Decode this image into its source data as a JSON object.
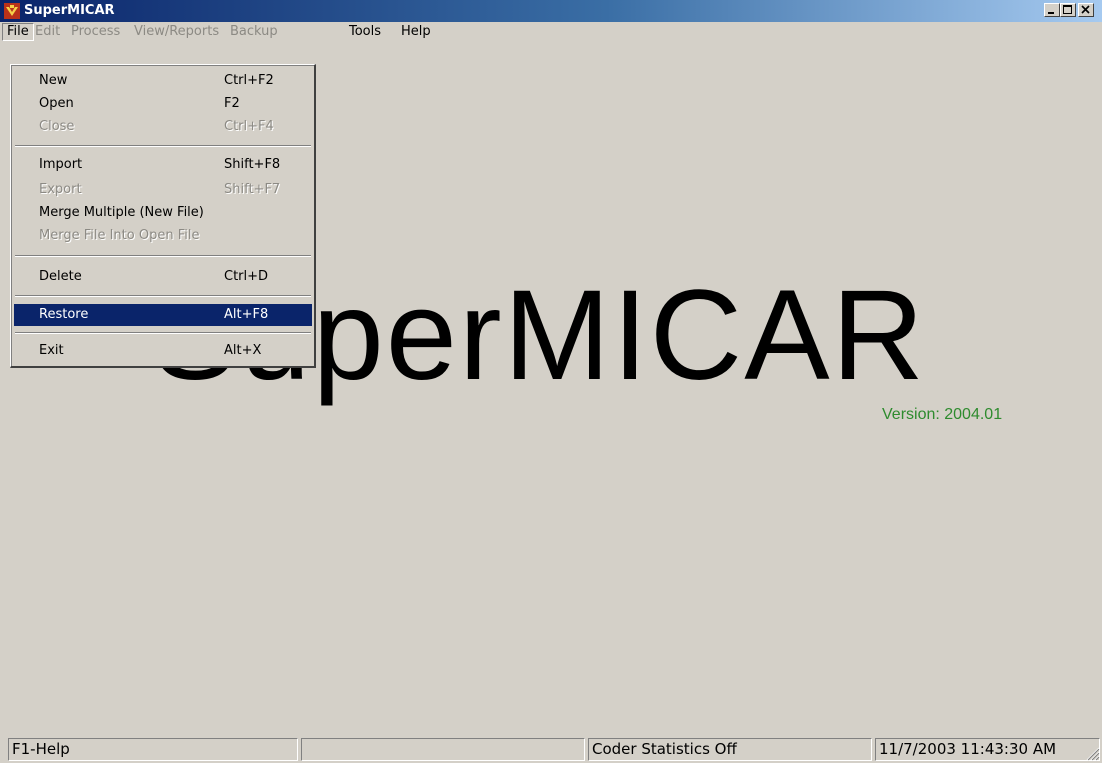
{
  "window": {
    "title": "SuperMICAR",
    "icon": "supermicar-app-icon",
    "controls": [
      "minimize-icon",
      "maximize-icon",
      "close-icon"
    ]
  },
  "menubar": {
    "items": [
      {
        "label": "File",
        "enabled": true,
        "open": true
      },
      {
        "label": "Edit",
        "enabled": false
      },
      {
        "label": "Process",
        "enabled": false
      },
      {
        "label": "View/Reports",
        "enabled": false
      },
      {
        "label": "Backup",
        "enabled": false
      },
      {
        "label": "Tools",
        "enabled": true
      },
      {
        "label": "Help",
        "enabled": true
      }
    ]
  },
  "file_menu": {
    "items": [
      {
        "label": "New",
        "shortcut": "Ctrl+F2",
        "enabled": true
      },
      {
        "label": "Open",
        "shortcut": "F2",
        "enabled": true
      },
      {
        "label": "Close",
        "shortcut": "Ctrl+F4",
        "enabled": false
      },
      {
        "label": "Import",
        "shortcut": "Shift+F8",
        "enabled": true
      },
      {
        "label": "Export",
        "shortcut": "Shift+F7",
        "enabled": false
      },
      {
        "label": "Merge Multiple (New File)",
        "shortcut": "",
        "enabled": true
      },
      {
        "label": "Merge File Into Open File",
        "shortcut": "",
        "enabled": false
      },
      {
        "label": "Delete",
        "shortcut": "Ctrl+D",
        "enabled": true
      },
      {
        "label": "Restore",
        "shortcut": "Alt+F8",
        "enabled": true,
        "selected": true
      },
      {
        "label": "Exit",
        "shortcut": "Alt+X",
        "enabled": true
      }
    ]
  },
  "splash": {
    "title": "SuperMICAR",
    "version": "Version: 2004.01",
    "version_color": "#2e8b2e"
  },
  "statusbar": {
    "help": "F1-Help",
    "panel2": "",
    "coder_stats": "Coder Statistics Off",
    "datetime": "11/7/2003 11:43:30 AM"
  },
  "colors": {
    "face": "#d4d0c8",
    "title_active": "#0a246a",
    "highlight": "#0a246a",
    "disabled_text": "#8c8a84"
  }
}
